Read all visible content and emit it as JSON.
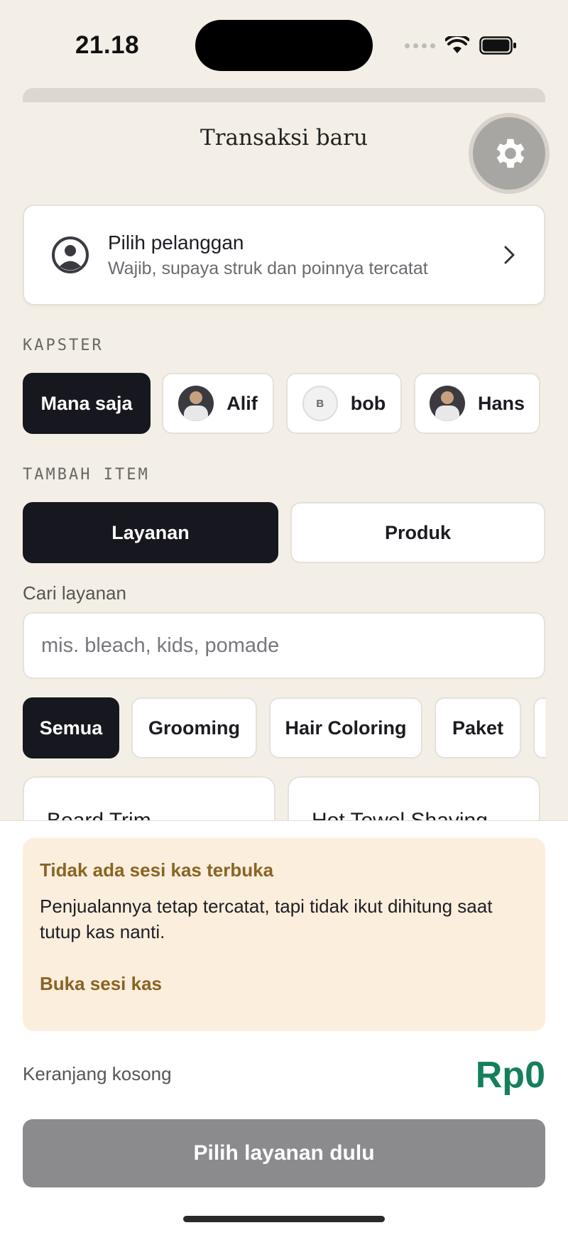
{
  "status_bar": {
    "time": "21.18"
  },
  "header": {
    "title": "Transaksi baru",
    "settings_icon": "gear-icon"
  },
  "customer": {
    "title": "Pilih pelanggan",
    "subtitle": "Wajib, supaya struk dan poinnya tercatat",
    "icon": "user-circle-icon"
  },
  "kapster": {
    "label": "KAPSTER",
    "items": [
      {
        "label": "Mana saja",
        "selected": true
      },
      {
        "label": "Alif",
        "avatar": "photo"
      },
      {
        "label": "bob",
        "avatar_letter": "B"
      },
      {
        "label": "Hans",
        "avatar": "photo"
      }
    ]
  },
  "add_item": {
    "label": "TAMBAH ITEM",
    "tabs": [
      {
        "label": "Layanan",
        "selected": true
      },
      {
        "label": "Produk",
        "selected": false
      }
    ]
  },
  "search": {
    "label": "Cari layanan",
    "placeholder": "mis. bleach, kids, pomade",
    "value": ""
  },
  "categories": [
    {
      "label": "Semua",
      "selected": true
    },
    {
      "label": "Grooming"
    },
    {
      "label": "Hair Coloring"
    },
    {
      "label": "Paket"
    }
  ],
  "services": [
    {
      "name": "Beard Trim"
    },
    {
      "name": "Hot Towel Shaving"
    }
  ],
  "warning": {
    "title": "Tidak ada sesi kas terbuka",
    "text": "Penjualannya tetap tercatat, tapi tidak ikut dihitung saat tutup kas nanti.",
    "link": "Buka sesi kas"
  },
  "cart": {
    "label": "Keranjang kosong",
    "total": "Rp0",
    "button": "Pilih layanan dulu"
  },
  "colors": {
    "dark": "#17171f",
    "accent_green": "#14805a",
    "warning_bg": "#fbeedd",
    "warning_text": "#8a6424"
  }
}
